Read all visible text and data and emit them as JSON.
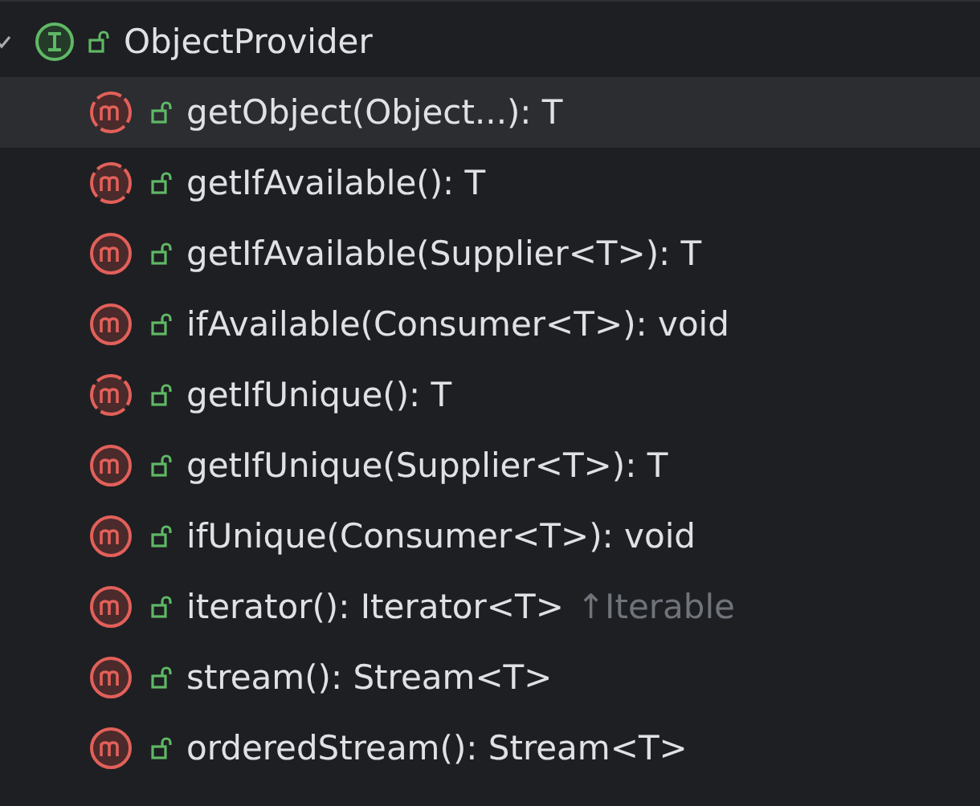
{
  "root": {
    "name": "ObjectProvider",
    "kind": "interface",
    "expanded": true,
    "selected": false,
    "children": [
      {
        "name": "getObject(Object...): T",
        "kind": "abstract",
        "selected": true
      },
      {
        "name": "getIfAvailable(): T",
        "kind": "abstract",
        "selected": false
      },
      {
        "name": "getIfAvailable(Supplier<T>): T",
        "kind": "method",
        "selected": false
      },
      {
        "name": "ifAvailable(Consumer<T>): void",
        "kind": "method",
        "selected": false
      },
      {
        "name": "getIfUnique(): T",
        "kind": "abstract",
        "selected": false
      },
      {
        "name": "getIfUnique(Supplier<T>): T",
        "kind": "method",
        "selected": false
      },
      {
        "name": "ifUnique(Consumer<T>): void",
        "kind": "method",
        "selected": false
      },
      {
        "name": "iterator(): Iterator<T>",
        "kind": "method",
        "selected": false,
        "hint": "↑Iterable"
      },
      {
        "name": "stream(): Stream<T>",
        "kind": "method",
        "selected": false
      },
      {
        "name": "orderedStream(): Stream<T>",
        "kind": "method",
        "selected": false
      }
    ]
  }
}
